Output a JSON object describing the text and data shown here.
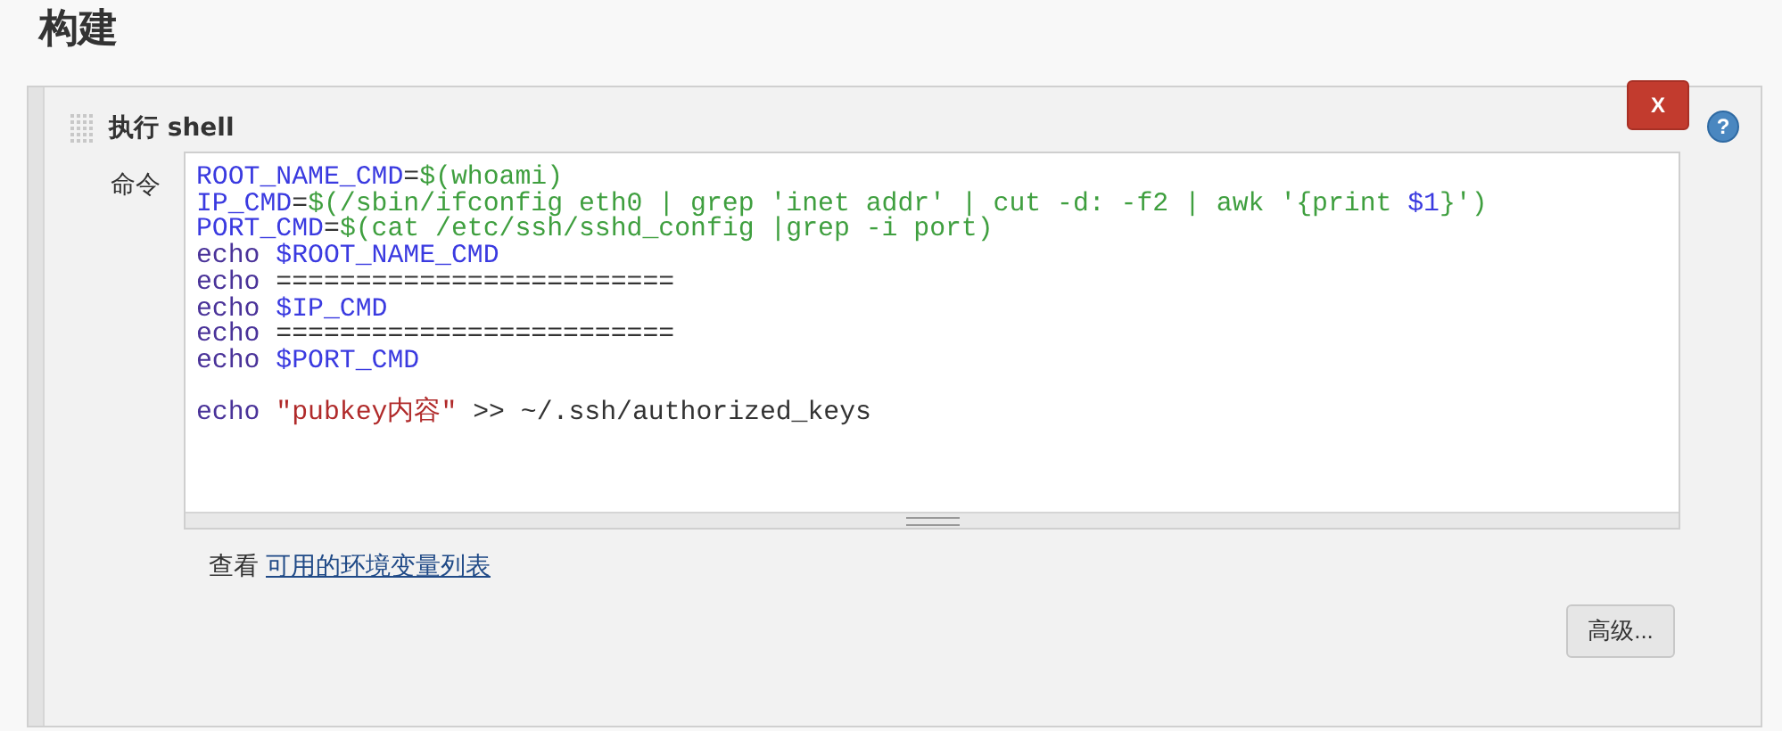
{
  "section_title": "构建",
  "step": {
    "title": "执行 shell",
    "close_button": "X",
    "help_button": "?",
    "field_label": "命令",
    "code_lines": [
      {
        "tokens": [
          {
            "kind": "var",
            "text": "ROOT_NAME_CMD"
          },
          {
            "kind": "plain",
            "text": "="
          },
          {
            "kind": "cmd",
            "text": "$(whoami)"
          }
        ]
      },
      {
        "tokens": [
          {
            "kind": "var",
            "text": "IP_CMD"
          },
          {
            "kind": "plain",
            "text": "="
          },
          {
            "kind": "cmd",
            "text": "$(/sbin/ifconfig eth0 | grep 'inet addr' | cut -d: -f2 | awk '{print"
          },
          {
            "kind": "var",
            "text": "$1",
            "space_before": true
          },
          {
            "kind": "cmd",
            "text": "}')"
          }
        ]
      },
      {
        "tokens": [
          {
            "kind": "var",
            "text": "PORT_CMD"
          },
          {
            "kind": "plain",
            "text": "="
          },
          {
            "kind": "cmd",
            "text": "$(cat /etc/ssh/sshd_config |grep -i port)"
          }
        ]
      },
      {
        "tokens": [
          {
            "kind": "keyword",
            "text": "echo"
          },
          {
            "kind": "var",
            "text": "$ROOT_NAME_CMD",
            "space_before": true
          }
        ]
      },
      {
        "tokens": [
          {
            "kind": "keyword",
            "text": "echo"
          },
          {
            "kind": "plain",
            "text": "=========================",
            "space_before": true
          }
        ]
      },
      {
        "tokens": [
          {
            "kind": "keyword",
            "text": "echo"
          },
          {
            "kind": "var",
            "text": "$IP_CMD",
            "space_before": true
          }
        ]
      },
      {
        "tokens": [
          {
            "kind": "keyword",
            "text": "echo"
          },
          {
            "kind": "plain",
            "text": "=========================",
            "space_before": true
          }
        ]
      },
      {
        "tokens": [
          {
            "kind": "keyword",
            "text": "echo"
          },
          {
            "kind": "var",
            "text": "$PORT_CMD",
            "space_before": true
          }
        ]
      },
      {
        "blank_line_before": true,
        "tokens": [
          {
            "kind": "keyword",
            "text": "echo"
          },
          {
            "kind": "string",
            "text": "\"pubkey内容\"",
            "space_before": true
          },
          {
            "kind": "plain",
            "text": ">> ~/.ssh/authorized_keys",
            "space_before": true
          }
        ]
      }
    ],
    "hint_text": "查看",
    "hint_link": "可用的环境变量列表",
    "advanced_button": "高级..."
  }
}
